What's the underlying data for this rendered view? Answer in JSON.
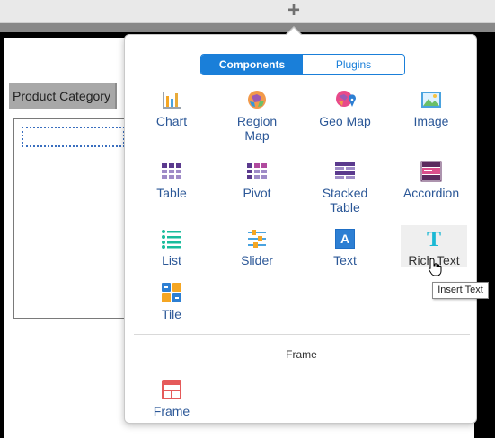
{
  "toolbar": {
    "add_icon": "plus-icon",
    "add_glyph": "+"
  },
  "canvas": {
    "category_header": "Product Category"
  },
  "popover": {
    "tabs": [
      {
        "label": "Components",
        "active": true
      },
      {
        "label": "Plugins",
        "active": false
      }
    ],
    "components": [
      {
        "label_lines": [
          "Chart"
        ],
        "icon": "chart-icon"
      },
      {
        "label_lines": [
          "Region",
          "Map"
        ],
        "icon": "region-map-icon"
      },
      {
        "label_lines": [
          "Geo Map"
        ],
        "icon": "geo-map-icon"
      },
      {
        "label_lines": [
          "Image"
        ],
        "icon": "image-icon"
      },
      {
        "label_lines": [
          "Table"
        ],
        "icon": "table-icon"
      },
      {
        "label_lines": [
          "Pivot"
        ],
        "icon": "pivot-icon"
      },
      {
        "label_lines": [
          "Stacked",
          "Table"
        ],
        "icon": "stacked-table-icon"
      },
      {
        "label_lines": [
          "Accordion"
        ],
        "icon": "accordion-icon"
      },
      {
        "label_lines": [
          "List"
        ],
        "icon": "list-icon"
      },
      {
        "label_lines": [
          "Slider"
        ],
        "icon": "slider-icon"
      },
      {
        "label_lines": [
          "Text"
        ],
        "icon": "text-icon"
      },
      {
        "label_lines": [
          "Rich Text"
        ],
        "icon": "rich-text-icon",
        "hovered": true
      },
      {
        "label_lines": [
          "Tile"
        ],
        "icon": "tile-icon"
      }
    ],
    "frame_section_title": "Frame",
    "frame_components": [
      {
        "label_lines": [
          "Frame"
        ],
        "icon": "frame-icon"
      }
    ]
  },
  "tooltip": {
    "text": "Insert Text"
  },
  "colors": {
    "accent": "#1a7fd9",
    "label_blue": "#2b5797"
  }
}
